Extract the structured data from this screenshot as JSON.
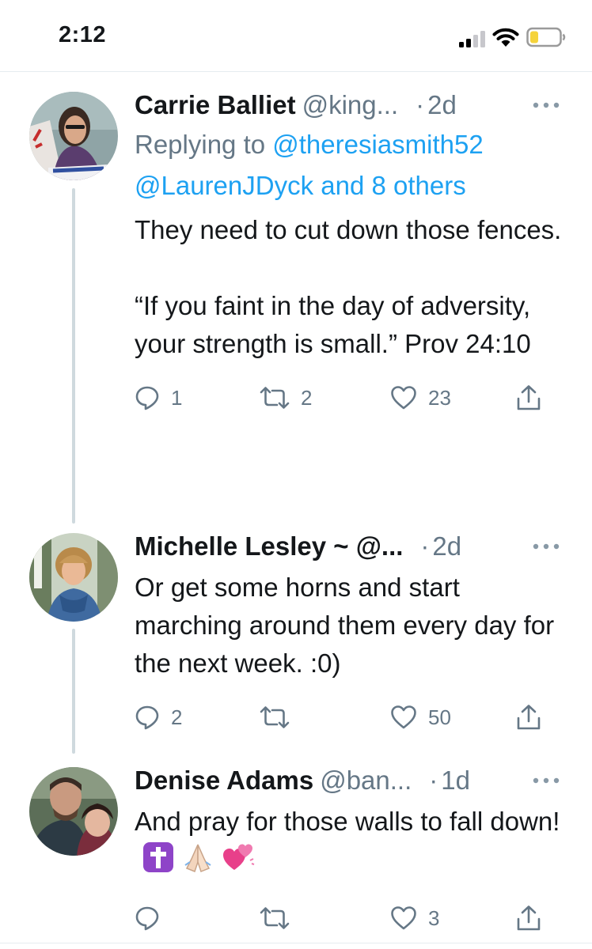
{
  "status_bar": {
    "time": "2:12",
    "icons": [
      "cellular-signal-icon",
      "wifi-icon",
      "battery-low-icon"
    ],
    "battery_color": "#f5d33b"
  },
  "colors": {
    "link": "#1da1f2",
    "secondary_text": "#657786",
    "primary_text": "#14171a",
    "thread_line": "#cfd9de"
  },
  "tweets": [
    {
      "display_name": "Carrie Balliet",
      "handle": "@king...",
      "separator": "·",
      "time": "2d",
      "reply_prefix": "Replying to ",
      "reply_mention_1": "@theresiasmith52",
      "reply_mention_2": "@LaurenJDyck and 8 others",
      "text": "They need to cut down those fences.\n\n“If you faint in the day of adversity, your strength is small.” Prov 24:10",
      "reply_count": "1",
      "retweet_count": "2",
      "like_count": "23"
    },
    {
      "display_name": "Michelle Lesley ~ @...",
      "handle": "",
      "separator": "·",
      "time": "2d",
      "text": "Or get some horns and start marching around them every day for the next week. :0)",
      "reply_count": "2",
      "retweet_count": "",
      "like_count": "50"
    },
    {
      "display_name": "Denise Adams",
      "handle": "@ban...",
      "separator": "·",
      "time": "1d",
      "text": "And pray for those walls to fall down!",
      "emojis": [
        "latin-cross-emoji",
        "folded-hands-emoji",
        "two-hearts-emoji"
      ],
      "reply_count": "",
      "retweet_count": "",
      "like_count": "3"
    }
  ]
}
